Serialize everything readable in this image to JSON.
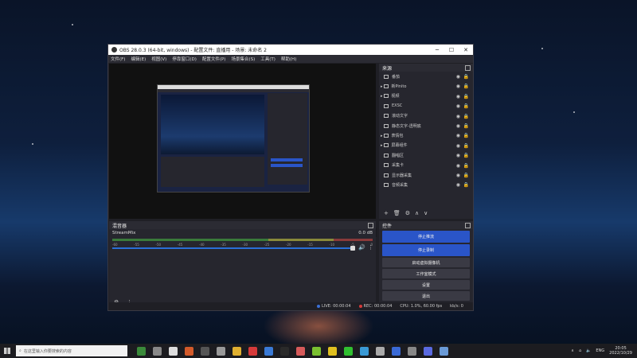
{
  "window": {
    "title": "OBS 28.0.3 (64-bit, windows) - 配置文件: 直播用 - 场景: 未命名 2",
    "min": "─",
    "max": "☐",
    "close": "✕"
  },
  "menu": [
    "文件(F)",
    "编辑(E)",
    "视图(V)",
    "停靠窗口(D)",
    "配置文件(P)",
    "场景集合(S)",
    "工具(T)",
    "帮助(H)"
  ],
  "sources": {
    "header": "来源",
    "items": [
      {
        "label": "番茄",
        "icon": "image-icon"
      },
      {
        "label": "新Pinito",
        "icon": "folder-icon",
        "group": true
      },
      {
        "label": "视频",
        "icon": "folder-icon",
        "group": true
      },
      {
        "label": "EXSC",
        "icon": "browser-icon"
      },
      {
        "label": "滚动文字",
        "icon": "text-icon"
      },
      {
        "label": "静态文字-透明底",
        "icon": "text-icon"
      },
      {
        "label": "表情包",
        "icon": "folder-icon",
        "group": true
      },
      {
        "label": "屏幕组件",
        "icon": "folder-icon",
        "group": true
      },
      {
        "label": "翻唱区",
        "icon": "audio-icon"
      },
      {
        "label": "采集卡",
        "icon": "camera-icon"
      },
      {
        "label": "显示器采集",
        "icon": "monitor-icon"
      },
      {
        "label": "音频采集",
        "icon": "audio-icon"
      }
    ],
    "toolbar": [
      "+",
      "🗑",
      "⚙",
      "∧",
      "∨"
    ]
  },
  "mixer": {
    "header": "混音器",
    "channel": "StreamMix",
    "level": "0.0 dB",
    "ticks": [
      "-60",
      "-55",
      "-50",
      "-45",
      "-40",
      "-35",
      "-30",
      "-25",
      "-20",
      "-15",
      "-10",
      "-5",
      "0"
    ],
    "volume_fraction": 0.93
  },
  "controls": {
    "header": "控件",
    "buttons": [
      {
        "label": "停止推流",
        "primary": true
      },
      {
        "label": "停止录制",
        "primary": true
      },
      {
        "label": "启动虚拟摄像机",
        "primary": false
      },
      {
        "label": "工作室模式",
        "primary": false
      },
      {
        "label": "设置",
        "primary": false
      },
      {
        "label": "退出",
        "primary": false
      }
    ]
  },
  "status": {
    "live": "LIVE: 00:00:04",
    "rec": "REC: 00:00:04",
    "cpu": "CPU: 1.0%, 60.00 fps",
    "kbps": "kb/s: 0"
  },
  "inner_preview_search": "在这里输入你要搜索的内容",
  "taskbar": {
    "search_placeholder": "在这里输入你要搜索的内容",
    "lang": "ENG",
    "time": "20:05",
    "date": "2022/10/29"
  },
  "colors": {
    "accent": "#2a55c8",
    "bg": "#1f1f25",
    "panel": "#26262e"
  }
}
